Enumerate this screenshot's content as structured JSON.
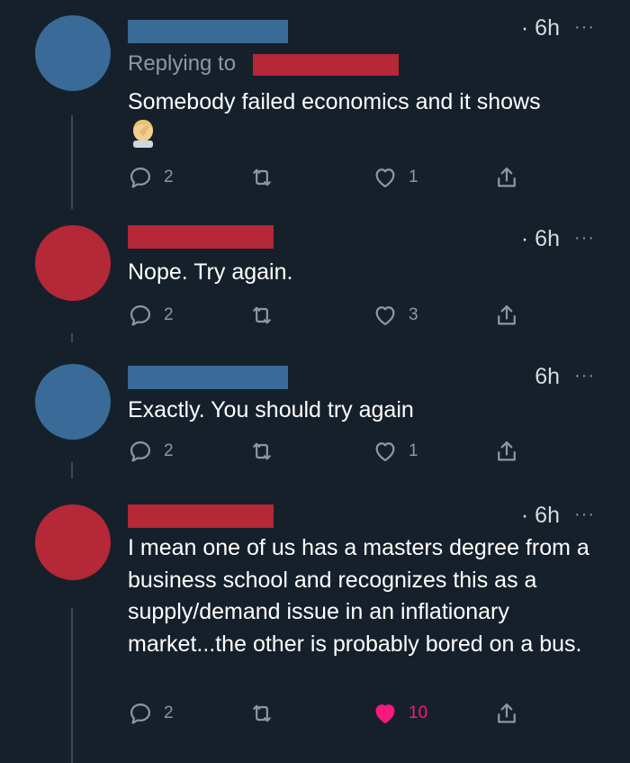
{
  "colors": {
    "background": "#16202a",
    "blue_account": "#3a6a98",
    "red_account": "#b52838",
    "muted": "#8b98a5",
    "like_active": "#f91880"
  },
  "tweets": [
    {
      "avatar": "blue",
      "time": "· 6h",
      "more": "···",
      "replying_label": "Replying to",
      "text": "Somebody failed economics and it shows",
      "emoji": "person-facepalming-emoji",
      "replies": "2",
      "retweets": "",
      "likes": "1",
      "liked": false
    },
    {
      "avatar": "red",
      "time": "· 6h",
      "more": "···",
      "text": "Nope. Try again.",
      "replies": "2",
      "retweets": "",
      "likes": "3",
      "liked": false
    },
    {
      "avatar": "blue",
      "time": "6h",
      "more": "···",
      "text": "Exactly.  You should try again",
      "replies": "2",
      "retweets": "",
      "likes": "1",
      "liked": false
    },
    {
      "avatar": "red",
      "time": "· 6h",
      "more": "···",
      "text": "I mean one of us has a masters degree from a business school and recognizes this as a supply/demand issue in an inflationary market...the other is probably bored on a bus.",
      "replies": "2",
      "retweets": "",
      "likes": "10",
      "liked": true
    }
  ]
}
